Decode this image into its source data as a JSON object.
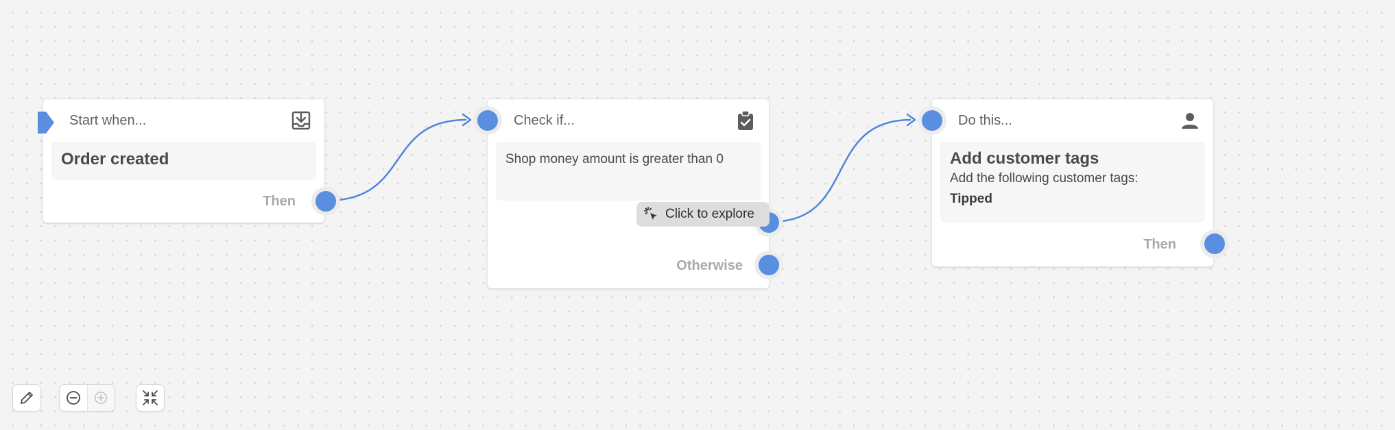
{
  "colors": {
    "accent": "#5a8ee0",
    "wire": "#4f86db",
    "canvas": "#f4f4f4"
  },
  "trigger_node": {
    "header": "Start when...",
    "icon": "download-tray-icon",
    "title": "Order created",
    "output_label": "Then"
  },
  "condition_node": {
    "header": "Check if...",
    "icon": "clipboard-check-icon",
    "text": "Shop money amount is greater than 0",
    "tooltip": "Click to explore",
    "tooltip_icon": "cursor-click-icon",
    "otherwise_label": "Otherwise"
  },
  "action_node": {
    "header": "Do this...",
    "icon": "person-icon",
    "title": "Add customer tags",
    "text": "Add the following customer tags:",
    "tag": "Tipped",
    "output_label": "Then"
  },
  "toolbar": {
    "edit_icon": "pencil-icon",
    "zoom_out_icon": "zoom-out-icon",
    "zoom_in_icon": "zoom-in-icon",
    "fit_icon": "collapse-arrows-icon"
  }
}
